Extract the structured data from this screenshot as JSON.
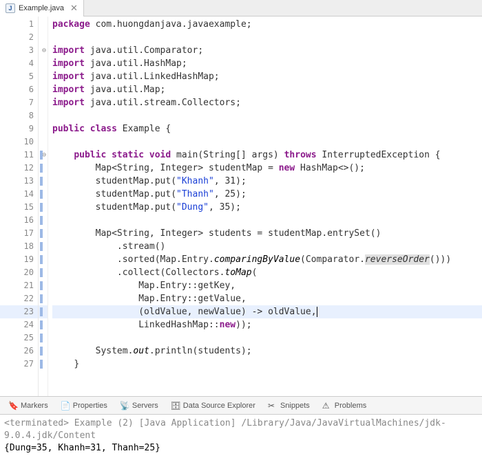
{
  "tab": {
    "filename": "Example.java"
  },
  "code": {
    "lines": [
      {
        "n": 1,
        "marker": "",
        "pre": "",
        "tokens": [
          [
            "kw",
            "package"
          ],
          [
            "",
            " com.huongdanjava.javaexample;"
          ]
        ]
      },
      {
        "n": 2,
        "marker": "",
        "pre": "",
        "tokens": []
      },
      {
        "n": 3,
        "marker": "",
        "fold": true,
        "pre": "",
        "tokens": [
          [
            "kw",
            "import"
          ],
          [
            "",
            " java.util.Comparator;"
          ]
        ]
      },
      {
        "n": 4,
        "marker": "",
        "pre": "",
        "tokens": [
          [
            "kw",
            "import"
          ],
          [
            "",
            " java.util.HashMap;"
          ]
        ]
      },
      {
        "n": 5,
        "marker": "",
        "pre": "",
        "tokens": [
          [
            "kw",
            "import"
          ],
          [
            "",
            " java.util.LinkedHashMap;"
          ]
        ]
      },
      {
        "n": 6,
        "marker": "",
        "pre": "",
        "tokens": [
          [
            "kw",
            "import"
          ],
          [
            "",
            " java.util.Map;"
          ]
        ]
      },
      {
        "n": 7,
        "marker": "",
        "pre": "",
        "tokens": [
          [
            "kw",
            "import"
          ],
          [
            "",
            " java.util.stream.Collectors;"
          ]
        ]
      },
      {
        "n": 8,
        "marker": "",
        "pre": "",
        "tokens": []
      },
      {
        "n": 9,
        "marker": "",
        "pre": "",
        "tokens": [
          [
            "kw",
            "public"
          ],
          [
            "",
            " "
          ],
          [
            "kw",
            "class"
          ],
          [
            "",
            " Example {"
          ]
        ]
      },
      {
        "n": 10,
        "marker": "",
        "pre": "",
        "tokens": []
      },
      {
        "n": 11,
        "marker": "blue",
        "fold": true,
        "pre": "    ",
        "tokens": [
          [
            "kw",
            "public"
          ],
          [
            "",
            " "
          ],
          [
            "kw",
            "static"
          ],
          [
            "",
            " "
          ],
          [
            "kw",
            "void"
          ],
          [
            "",
            " main(String[] args) "
          ],
          [
            "kw",
            "throws"
          ],
          [
            "",
            " InterruptedException {"
          ]
        ]
      },
      {
        "n": 12,
        "marker": "blue",
        "pre": "        ",
        "tokens": [
          [
            "",
            "Map<String, Integer> studentMap = "
          ],
          [
            "kw",
            "new"
          ],
          [
            "",
            " HashMap<>();"
          ]
        ]
      },
      {
        "n": 13,
        "marker": "blue",
        "pre": "        ",
        "tokens": [
          [
            "",
            "studentMap.put("
          ],
          [
            "str",
            "\"Khanh\""
          ],
          [
            "",
            ", 31);"
          ]
        ]
      },
      {
        "n": 14,
        "marker": "blue",
        "pre": "        ",
        "tokens": [
          [
            "",
            "studentMap.put("
          ],
          [
            "str",
            "\"Thanh\""
          ],
          [
            "",
            ", 25);"
          ]
        ]
      },
      {
        "n": 15,
        "marker": "blue",
        "pre": "        ",
        "tokens": [
          [
            "",
            "studentMap.put("
          ],
          [
            "str",
            "\"Dung\""
          ],
          [
            "",
            ", 35);"
          ]
        ]
      },
      {
        "n": 16,
        "marker": "blue",
        "pre": "",
        "tokens": []
      },
      {
        "n": 17,
        "marker": "blue",
        "pre": "        ",
        "tokens": [
          [
            "",
            "Map<String, Integer> students = studentMap.entrySet()"
          ]
        ]
      },
      {
        "n": 18,
        "marker": "blue",
        "pre": "            ",
        "tokens": [
          [
            "",
            ".stream()"
          ]
        ]
      },
      {
        "n": 19,
        "marker": "blue",
        "pre": "            ",
        "tokens": [
          [
            "",
            ".sorted(Map.Entry."
          ],
          [
            "mtd-static",
            "comparingByValue"
          ],
          [
            "",
            "(Comparator."
          ],
          [
            "hl-call",
            "reverseOrder"
          ],
          [
            "",
            "()))"
          ]
        ]
      },
      {
        "n": 20,
        "marker": "blue",
        "pre": "            ",
        "tokens": [
          [
            "",
            ".collect(Collectors."
          ],
          [
            "mtd-static",
            "toMap"
          ],
          [
            "",
            "("
          ]
        ]
      },
      {
        "n": 21,
        "marker": "blue",
        "pre": "                ",
        "tokens": [
          [
            "",
            "Map.Entry::getKey,"
          ]
        ]
      },
      {
        "n": 22,
        "marker": "blue",
        "pre": "                ",
        "tokens": [
          [
            "",
            "Map.Entry::getValue,"
          ]
        ]
      },
      {
        "n": 23,
        "marker": "blue",
        "hl": true,
        "pre": "                ",
        "tokens": [
          [
            "",
            "(oldValue, newValue) -> oldValue,"
          ],
          [
            "cursor",
            ""
          ]
        ]
      },
      {
        "n": 24,
        "marker": "blue",
        "pre": "                ",
        "tokens": [
          [
            "",
            "LinkedHashMap::"
          ],
          [
            "kw",
            "new"
          ],
          [
            "",
            "));"
          ]
        ]
      },
      {
        "n": 25,
        "marker": "blue",
        "pre": "",
        "tokens": []
      },
      {
        "n": 26,
        "marker": "blue",
        "pre": "        ",
        "tokens": [
          [
            "",
            "System."
          ],
          [
            "mtd-static",
            "out"
          ],
          [
            "",
            ".println(students);"
          ]
        ]
      },
      {
        "n": 27,
        "marker": "blue",
        "pre": "    ",
        "tokens": [
          [
            "",
            "}"
          ]
        ]
      }
    ]
  },
  "bottom_tabs": {
    "items": [
      {
        "icon": "🔖",
        "label": "Markers"
      },
      {
        "icon": "📄",
        "label": "Properties"
      },
      {
        "icon": "📡",
        "label": "Servers"
      },
      {
        "icon": "🗄",
        "label": "Data Source Explorer"
      },
      {
        "icon": "✂",
        "label": "Snippets"
      },
      {
        "icon": "⚠",
        "label": "Problems"
      }
    ]
  },
  "console": {
    "status": "<terminated> Example (2) [Java Application] /Library/Java/JavaVirtualMachines/jdk-9.0.4.jdk/Content",
    "output": "{Dung=35, Khanh=31, Thanh=25}"
  }
}
